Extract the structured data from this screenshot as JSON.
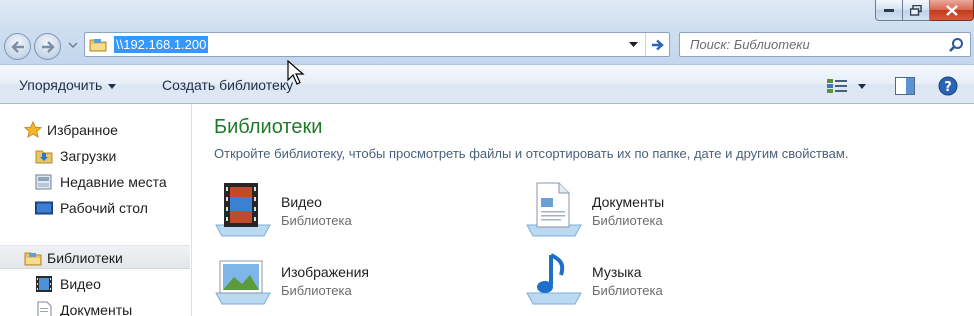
{
  "address": {
    "path": "\\\\192.168.1.200"
  },
  "search": {
    "placeholder": "Поиск: Библиотеки"
  },
  "toolbar": {
    "organize": "Упорядочить",
    "new_library": "Создать библиотеку"
  },
  "sidebar": {
    "favorites": {
      "label": "Избранное",
      "items": [
        {
          "label": "Загрузки",
          "icon": "downloads-folder-icon"
        },
        {
          "label": "Недавние места",
          "icon": "recent-places-icon"
        },
        {
          "label": "Рабочий стол",
          "icon": "desktop-icon"
        }
      ]
    },
    "libraries": {
      "label": "Библиотеки",
      "items": [
        {
          "label": "Видео",
          "icon": "video-library-icon"
        },
        {
          "label": "Документы",
          "icon": "documents-library-icon"
        }
      ]
    }
  },
  "main": {
    "title": "Библиотеки",
    "subtitle": "Откройте библиотеку, чтобы просмотреть файлы и отсортировать их по папке, дате и другим свойствам.",
    "libraries": [
      {
        "name": "Видео",
        "kind": "Библиотека",
        "icon": "video-library-icon"
      },
      {
        "name": "Документы",
        "kind": "Библиотека",
        "icon": "documents-library-icon"
      },
      {
        "name": "Изображения",
        "kind": "Библиотека",
        "icon": "pictures-library-icon"
      },
      {
        "name": "Музыка",
        "kind": "Библиотека",
        "icon": "music-library-icon"
      }
    ]
  },
  "colors": {
    "title_green": "#1e7a2a",
    "selection_blue": "#3399ff",
    "chrome_blue": "#cfdff0"
  }
}
